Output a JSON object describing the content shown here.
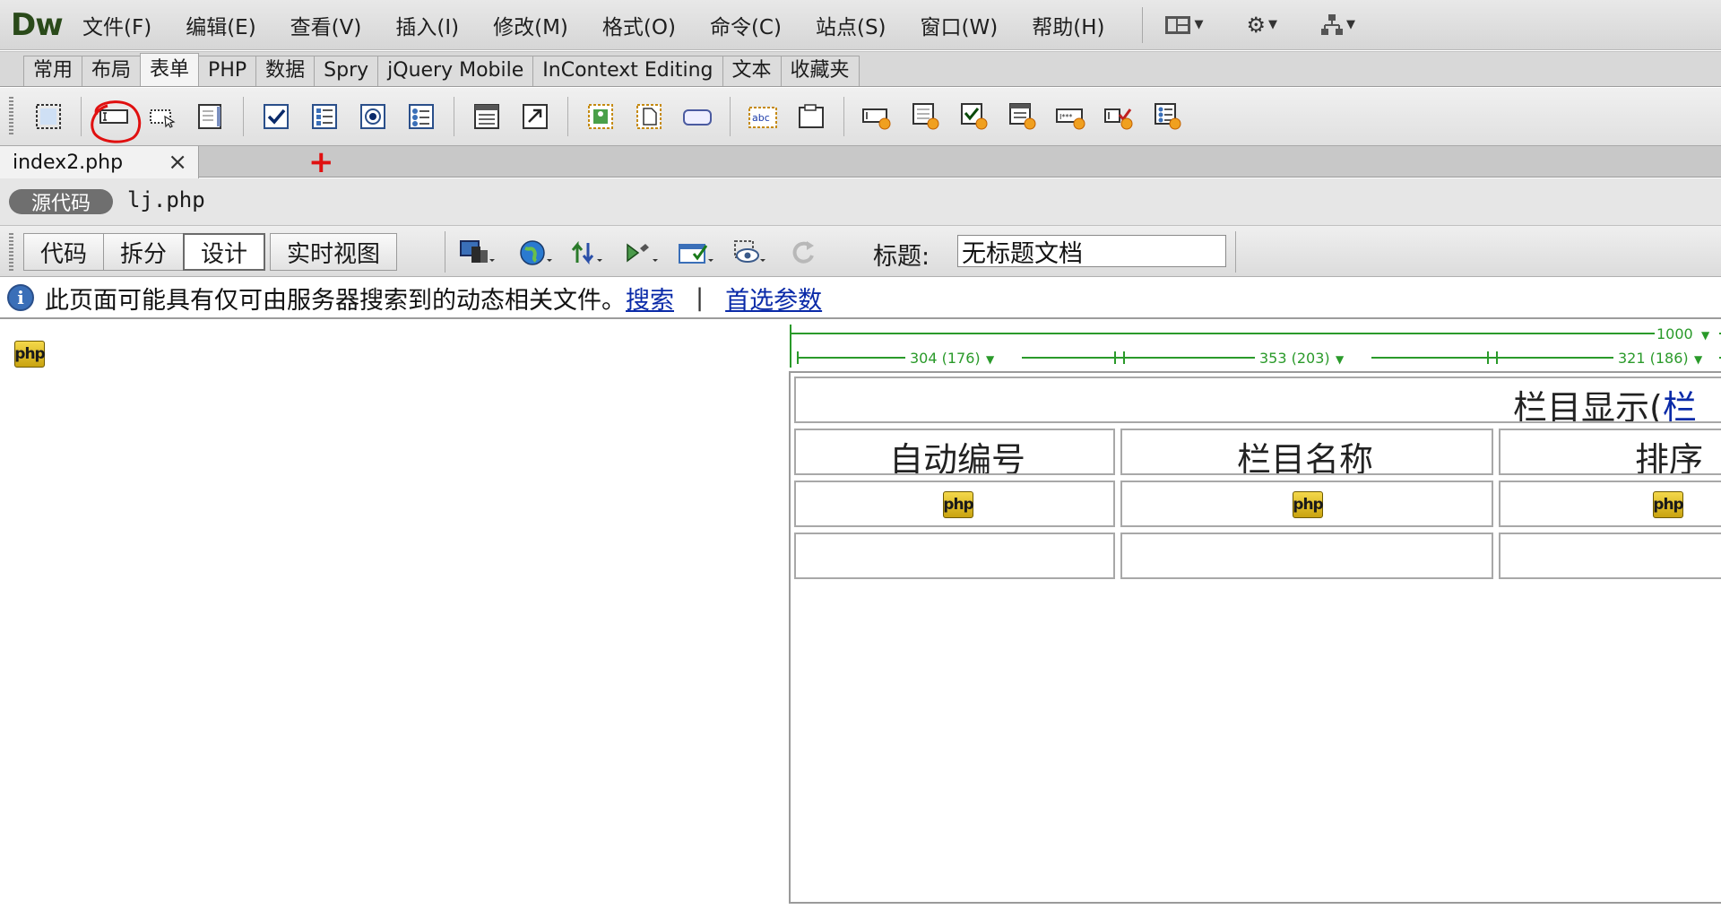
{
  "app": {
    "logo": "Dw"
  },
  "menu": {
    "items": [
      "文件(F)",
      "编辑(E)",
      "查看(V)",
      "插入(I)",
      "修改(M)",
      "格式(O)",
      "命令(C)",
      "站点(S)",
      "窗口(W)",
      "帮助(H)"
    ],
    "controls": [
      "layout-icon",
      "gear-icon",
      "site-icon"
    ]
  },
  "insert_panel": {
    "tabs": [
      "常用",
      "布局",
      "表单",
      "PHP",
      "数据",
      "Spry",
      "jQuery Mobile",
      "InContext Editing",
      "文本",
      "收藏夹"
    ],
    "active_tab": "表单",
    "icons": [
      "form-icon",
      "text-field-icon",
      "textarea-icon",
      "file-field-icon",
      "checkbox-icon",
      "checkbox-group-icon",
      "radio-icon",
      "radio-group-icon",
      "select-list-icon",
      "jump-menu-icon",
      "image-field-icon",
      "file-upload-icon",
      "button-icon",
      "label-icon",
      "fieldset-icon",
      "spry-text-field-icon",
      "spry-textarea-icon",
      "spry-checkbox-icon",
      "spry-select-icon",
      "spry-password-icon",
      "spry-confirm-icon",
      "spry-radio-group-icon"
    ],
    "highlight_color": "#e01010"
  },
  "document_tab": {
    "filename": "index2.php",
    "close": "×",
    "new_tab": "+"
  },
  "related_files": {
    "source_label": "源代码",
    "file": "lj.php"
  },
  "doc_toolbar": {
    "views": [
      "代码",
      "拆分",
      "设计",
      "实时视图"
    ],
    "active_view": "设计",
    "title_label": "标题:",
    "title_value": "无标题文档"
  },
  "info_bar": {
    "message": "此页面可能具有仅可由服务器搜索到的动态相关文件。",
    "link_search": "搜索",
    "separator": "|",
    "link_prefs": "首选参数"
  },
  "canvas": {
    "php_marker": "php",
    "ruler": {
      "total": "1000",
      "col1": "304 (176)",
      "col2": "353 (203)",
      "col3": "321 (186)",
      "color": "#2a9a2a"
    },
    "table": {
      "caption_text": "栏目显示(",
      "caption_link": "栏",
      "headers": [
        "自动编号",
        "栏目名称",
        "排序"
      ]
    }
  }
}
